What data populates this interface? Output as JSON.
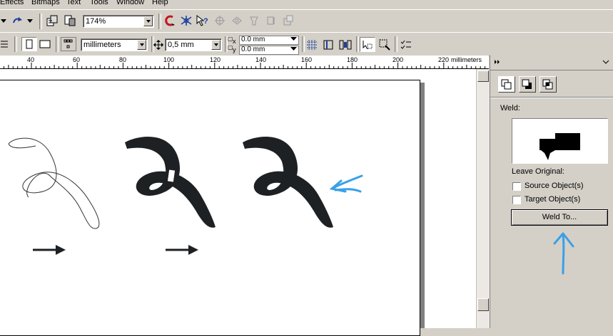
{
  "menu": {
    "items": [
      "Effects",
      "Bitmaps",
      "Text",
      "Tools",
      "Window",
      "Help"
    ]
  },
  "toolbar": {
    "zoom_value": "174%"
  },
  "property_bar": {
    "units_value": "millimeters",
    "nudge_value": "0,5 mm",
    "dup_x_label": "x",
    "dup_y_label": "y",
    "dup_x_value": "0.0 mm",
    "dup_y_value": "0.0 mm"
  },
  "ruler": {
    "labels": [
      "40",
      "60",
      "80",
      "100",
      "120",
      "140",
      "160",
      "180",
      "200",
      "220"
    ],
    "unit": "millimeters"
  },
  "docker": {
    "weld_label": "Weld:",
    "leave_original_label": "Leave Original:",
    "source_objects_label": "Source Object(s)",
    "target_objects_label": "Target Object(s)",
    "weld_to_button": "Weld To...",
    "source_checked": false,
    "target_checked": false
  },
  "colors": {
    "annotation_blue": "#3aa0e8",
    "shape_fill": "#1e2123",
    "ui_face": "#d4d0c8"
  }
}
